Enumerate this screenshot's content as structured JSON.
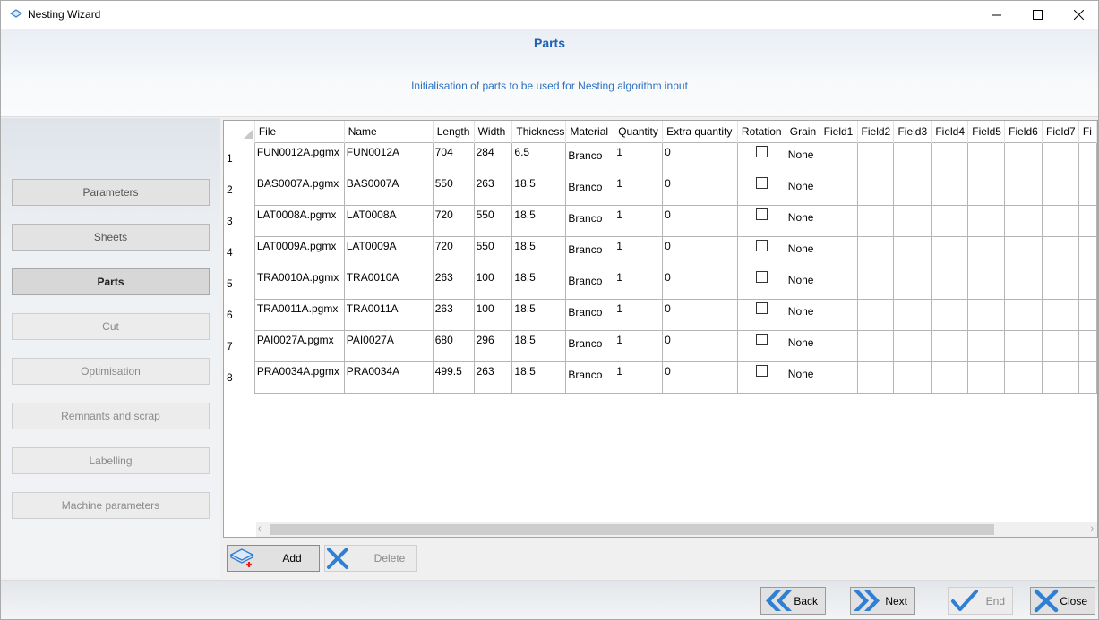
{
  "window": {
    "title": "Nesting Wizard",
    "minimize": "—",
    "maximize": "☐",
    "close": "✕"
  },
  "header": {
    "title": "Parts",
    "subtitle": "Initialisation of parts to be used for Nesting algorithm input"
  },
  "sidebar": {
    "items": [
      {
        "label": "Parameters",
        "state": "normal"
      },
      {
        "label": "Sheets",
        "state": "normal"
      },
      {
        "label": "Parts",
        "state": "active"
      },
      {
        "label": "Cut",
        "state": "disabled"
      },
      {
        "label": "Optimisation",
        "state": "disabled"
      },
      {
        "label": "Remnants and scrap",
        "state": "disabled"
      },
      {
        "label": "Labelling",
        "state": "disabled"
      },
      {
        "label": "Machine parameters",
        "state": "disabled"
      }
    ]
  },
  "grid": {
    "columns": [
      "File",
      "Name",
      "Length",
      "Width",
      "Thickness",
      "Material",
      "Quantity",
      "Extra quantity",
      "Rotation",
      "Grain",
      "Field1",
      "Field2",
      "Field3",
      "Field4",
      "Field5",
      "Field6",
      "Field7",
      "Fi"
    ],
    "rows": [
      {
        "n": "1",
        "file": "FUN0012A.pgmx",
        "name": "FUN0012A",
        "length": "704",
        "width": "284",
        "thickness": "6.5",
        "material": "Branco",
        "quantity": "1",
        "extra": "0",
        "rotation": false,
        "grain": "None"
      },
      {
        "n": "2",
        "file": "BAS0007A.pgmx",
        "name": "BAS0007A",
        "length": "550",
        "width": "263",
        "thickness": "18.5",
        "material": "Branco",
        "quantity": "1",
        "extra": "0",
        "rotation": false,
        "grain": "None"
      },
      {
        "n": "3",
        "file": "LAT0008A.pgmx",
        "name": "LAT0008A",
        "length": "720",
        "width": "550",
        "thickness": "18.5",
        "material": "Branco",
        "quantity": "1",
        "extra": "0",
        "rotation": false,
        "grain": "None"
      },
      {
        "n": "4",
        "file": "LAT0009A.pgmx",
        "name": "LAT0009A",
        "length": "720",
        "width": "550",
        "thickness": "18.5",
        "material": "Branco",
        "quantity": "1",
        "extra": "0",
        "rotation": false,
        "grain": "None"
      },
      {
        "n": "5",
        "file": "TRA0010A.pgmx",
        "name": "TRA0010A",
        "length": "263",
        "width": "100",
        "thickness": "18.5",
        "material": "Branco",
        "quantity": "1",
        "extra": "0",
        "rotation": false,
        "grain": "None"
      },
      {
        "n": "6",
        "file": "TRA0011A.pgmx",
        "name": "TRA0011A",
        "length": "263",
        "width": "100",
        "thickness": "18.5",
        "material": "Branco",
        "quantity": "1",
        "extra": "0",
        "rotation": false,
        "grain": "None"
      },
      {
        "n": "7",
        "file": "PAI0027A.pgmx",
        "name": "PAI0027A",
        "length": "680",
        "width": "296",
        "thickness": "18.5",
        "material": "Branco",
        "quantity": "1",
        "extra": "0",
        "rotation": false,
        "grain": "None"
      },
      {
        "n": "8",
        "file": "PRA0034A.pgmx",
        "name": "PRA0034A",
        "length": "499.5",
        "width": "263",
        "thickness": "18.5",
        "material": "Branco",
        "quantity": "1",
        "extra": "0",
        "rotation": false,
        "grain": "None"
      }
    ]
  },
  "actions": {
    "add_label": "Add",
    "delete_label": "Delete"
  },
  "footer": {
    "back_label": "Back",
    "next_label": "Next",
    "end_label": "End",
    "close_label": "Close"
  },
  "colors": {
    "header_title": "#1f62b5",
    "nav_icon_blue": "#2f7fd4",
    "add_plus_red": "#e02020"
  }
}
